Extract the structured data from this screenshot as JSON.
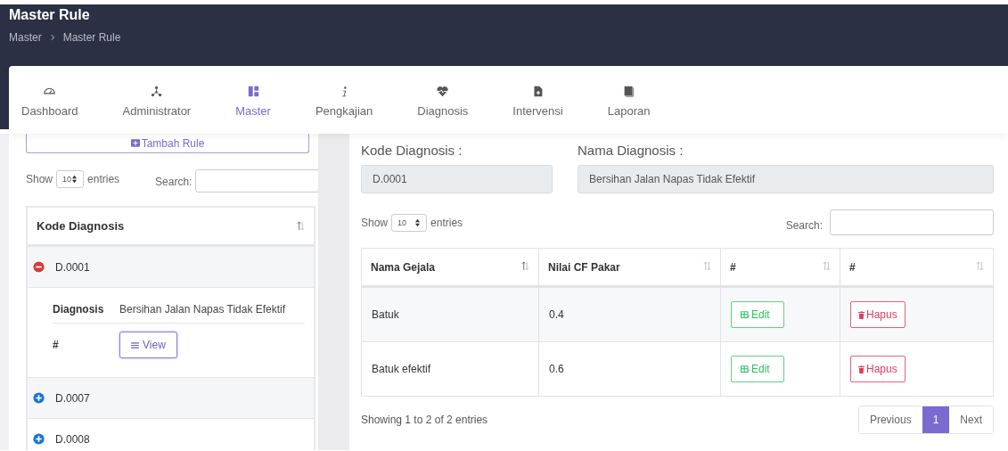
{
  "header": {
    "title": "Master Rule",
    "breadcrumb": [
      "Master",
      "Master Rule"
    ]
  },
  "nav": [
    {
      "label": "Dashboard",
      "selected": false
    },
    {
      "label": "Administrator",
      "selected": false
    },
    {
      "label": "Master",
      "selected": true
    },
    {
      "label": "Pengkajian",
      "selected": false
    },
    {
      "label": "Diagnosis",
      "selected": false
    },
    {
      "label": "Intervensi",
      "selected": false
    },
    {
      "label": "Laporan",
      "selected": false
    }
  ],
  "left": {
    "add_button": "Tambah Rule",
    "show_label": "Show",
    "page_size": "10",
    "entries_label": "entries",
    "search_label": "Search:",
    "column": "Kode Diagnosis",
    "rows": [
      {
        "code": "D.0001",
        "expanded": true,
        "details": [
          {
            "label": "Diagnosis",
            "value": "Bersihan Jalan Napas Tidak Efektif",
            "kind": "text"
          },
          {
            "label": "#",
            "value": "View",
            "kind": "button"
          }
        ]
      },
      {
        "code": "D.0007",
        "expanded": false
      },
      {
        "code": "D.0008",
        "expanded": false
      }
    ]
  },
  "right": {
    "kode_label": "Kode Diagnosis :",
    "kode_value": "D.0001",
    "nama_label": "Nama Diagnosis :",
    "nama_value": "Bersihan Jalan Napas Tidak Efektif",
    "show_label": "Show",
    "page_size": "10",
    "entries_label": "entries",
    "search_label": "Search:",
    "columns": [
      "Nama Gejala",
      "Nilai CF Pakar",
      "#",
      "#"
    ],
    "rows": [
      {
        "gejala": "Batuk",
        "cf": "0.4",
        "edit": "Edit",
        "hapus": "Hapus"
      },
      {
        "gejala": "Batuk efektif",
        "cf": "0.6",
        "edit": "Edit",
        "hapus": "Hapus"
      }
    ],
    "info": "Showing 1 to 2 of 2 entries",
    "pagination": [
      {
        "label": "Previous",
        "selected": false
      },
      {
        "label": "1",
        "selected": true
      },
      {
        "label": "Next",
        "selected": false
      }
    ]
  }
}
